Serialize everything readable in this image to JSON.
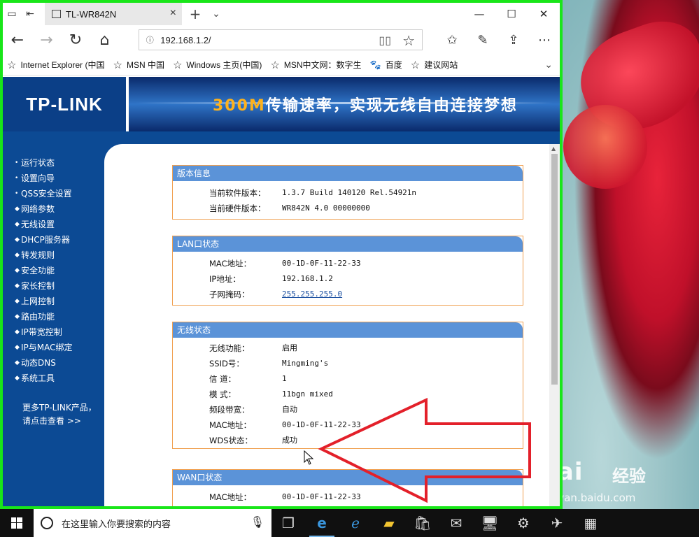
{
  "browser": {
    "tab_title": "TL-WR842N",
    "address_url": "192.168.1.2/",
    "favorites": [
      {
        "label": "Internet Explorer (中国",
        "icon": "star-icon"
      },
      {
        "label": "MSN 中国",
        "icon": "star-icon"
      },
      {
        "label": "Windows 主页(中国)",
        "icon": "star-icon"
      },
      {
        "label": "MSN中文网：数字生",
        "icon": "star-icon"
      },
      {
        "label": "百度",
        "icon": "paw-icon"
      },
      {
        "label": "建议网站",
        "icon": "star-icon"
      }
    ]
  },
  "router": {
    "logo": "TP-LINK",
    "slogan_highlight": "300M",
    "slogan_rest": "传输速率，实现无线自由连接梦想",
    "menu": [
      "运行状态",
      "设置向导",
      "QSS安全设置",
      "网络参数",
      "无线设置",
      "DHCP服务器",
      "转发规则",
      "安全功能",
      "家长控制",
      "上网控制",
      "路由功能",
      "IP带宽控制",
      "IP与MAC绑定",
      "动态DNS",
      "系统工具"
    ],
    "more_line1": "更多TP-LINK产品，",
    "more_line2": "请点击查看 >>"
  },
  "panels": {
    "version": {
      "title": "版本信息",
      "rows": [
        {
          "key": "当前软件版本：",
          "value": "1.3.7 Build 140120 Rel.54921n"
        },
        {
          "key": "当前硬件版本：",
          "value": "WR842N 4.0 00000000"
        }
      ]
    },
    "lan": {
      "title": "LAN口状态",
      "rows": [
        {
          "key": "MAC地址：",
          "value": "00-1D-0F-11-22-33"
        },
        {
          "key": "IP地址：",
          "value": "192.168.1.2"
        },
        {
          "key": "子网掩码：",
          "value": "255.255.255.0"
        }
      ]
    },
    "wireless": {
      "title": "无线状态",
      "rows": [
        {
          "key": "无线功能：",
          "value": "启用"
        },
        {
          "key": "SSID号：",
          "value": "Mingming's"
        },
        {
          "key": "信 道：",
          "value": "1"
        },
        {
          "key": "模 式：",
          "value": "11bgn mixed"
        },
        {
          "key": "频段带宽：",
          "value": "自动"
        },
        {
          "key": "MAC地址：",
          "value": "00-1D-0F-11-22-33"
        },
        {
          "key": "WDS状态：",
          "value": "成功"
        }
      ]
    },
    "wan": {
      "title": "WAN口状态",
      "rows": [
        {
          "key": "MAC地址：",
          "value": "00-1D-0F-11-22-33"
        }
      ]
    }
  },
  "taskbar": {
    "search_placeholder": "在这里输入你要搜索的内容"
  },
  "watermark": {
    "logo": "Bai",
    "cn": "经验",
    "url": "jingyan.baidu.com"
  },
  "colors": {
    "window_border": "#19e619",
    "router_blue": "#0c4a94",
    "panel_head": "#5b93d8",
    "panel_border": "#f0a050",
    "slogan_highlight": "#ffb21a",
    "arrow": "#e3202a"
  }
}
